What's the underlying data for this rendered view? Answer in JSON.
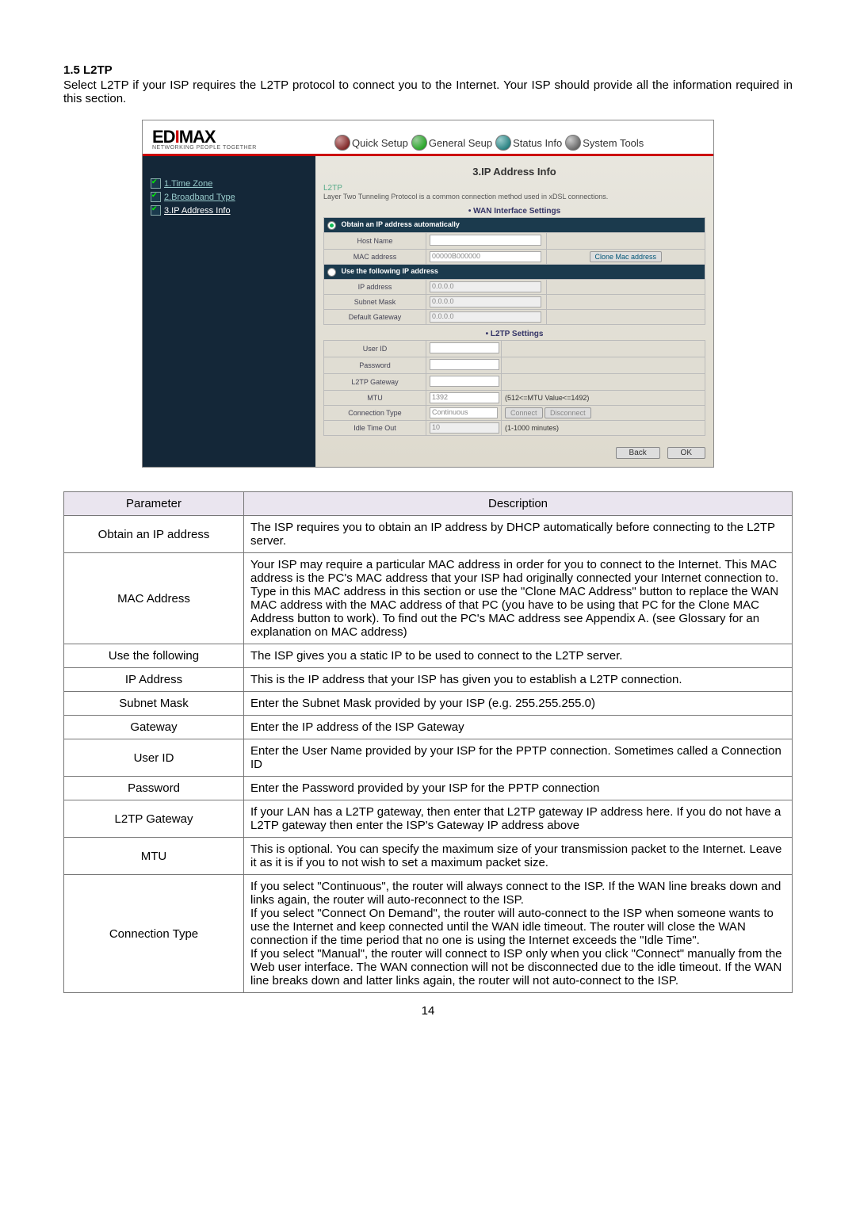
{
  "section_title": "1.5 L2TP",
  "intro_text": "Select L2TP if your ISP requires the L2TP protocol to connect you to the Internet. Your ISP should provide all the information required in this section.",
  "router": {
    "logo_main": "EDIMAX",
    "logo_sub": "NETWORKING PEOPLE TOGETHER",
    "tabs": {
      "quick": "Quick Setup",
      "general": "General Seup",
      "status": "Status Info",
      "system": "System Tools"
    },
    "sidebar": {
      "items": [
        {
          "label": "1.Time Zone"
        },
        {
          "label": "2.Broadband Type"
        },
        {
          "label": "3.IP Address Info"
        }
      ]
    },
    "content": {
      "page_title": "3.IP Address Info",
      "protocol_name": "L2TP",
      "protocol_desc": "Layer Two Tunneling Protocol is a common connection method used in xDSL connections.",
      "wan_heading": "• WAN Interface Settings",
      "radio1_label": "Obtain an IP address automatically",
      "host_name_label": "Host Name",
      "mac_addr_label": "MAC address",
      "mac_addr_value": "00000B000000",
      "clone_btn": "Clone Mac address",
      "radio2_label": "Use the following IP address",
      "ip_addr_label": "IP address",
      "ip_addr_value": "0.0.0.0",
      "subnet_label": "Subnet Mask",
      "subnet_value": "0.0.0.0",
      "gateway_label": "Default Gateway",
      "gateway_value": "0.0.0.0",
      "l2tp_heading": "• L2TP Settings",
      "user_id_label": "User ID",
      "password_label": "Password",
      "l2tp_gw_label": "L2TP Gateway",
      "mtu_label": "MTU",
      "mtu_value": "1392",
      "mtu_hint": "(512<=MTU Value<=1492)",
      "conn_type_label": "Connection Type",
      "conn_type_value": "Continuous",
      "connect_btn": "Connect",
      "disconnect_btn": "Disconnect",
      "idle_label": "Idle Time Out",
      "idle_value": "10",
      "idle_hint": "(1-1000 minutes)",
      "back_btn": "Back",
      "ok_btn": "OK"
    }
  },
  "param_table": {
    "headers": {
      "param": "Parameter",
      "desc": "Description"
    },
    "rows": [
      {
        "param": "Obtain an IP address",
        "desc": "The ISP requires you to obtain an IP address by DHCP automatically before connecting to the L2TP server."
      },
      {
        "param": "MAC Address",
        "desc": "Your ISP may require a particular MAC address in order for you to connect to the Internet. This MAC address is the PC's MAC address that your ISP had originally connected your Internet connection to. Type in this MAC address in this section or use the \"Clone MAC Address\" button to replace the WAN MAC address with the MAC address of that PC (you have to be using that PC for the Clone MAC Address button to work). To find out the PC's MAC address see Appendix A. (see Glossary for an explanation on MAC address)"
      },
      {
        "param": "Use the following",
        "desc": "The ISP gives you a static IP to be used to connect to the L2TP server."
      },
      {
        "param": "IP Address",
        "desc": "This is the IP address that your ISP has given you to establish a L2TP connection."
      },
      {
        "param": "Subnet Mask",
        "desc": "Enter the Subnet Mask provided by your ISP (e.g. 255.255.255.0)"
      },
      {
        "param": "Gateway",
        "desc": "Enter the IP address of the ISP Gateway"
      },
      {
        "param": "User ID",
        "desc": "Enter the User Name provided by your ISP for the PPTP connection. Sometimes called a Connection ID"
      },
      {
        "param": "Password",
        "desc": "Enter the Password provided by your ISP for the PPTP connection"
      },
      {
        "param": "L2TP Gateway",
        "desc": "If your LAN has a L2TP gateway, then enter that L2TP gateway IP address here. If you do not have a L2TP gateway then enter the ISP's Gateway IP address above"
      },
      {
        "param": "MTU",
        "desc": "This is optional. You can specify the maximum size of your transmission packet to the Internet. Leave it as it is if you to not wish to set a maximum packet size."
      },
      {
        "param": "Connection Type",
        "desc": "If you select \"Continuous\", the router will always connect to the ISP. If the WAN line breaks down and links again, the router will auto-reconnect to the ISP.\nIf you select \"Connect On Demand\", the router will auto-connect to the ISP when someone wants to use the Internet and keep connected until the WAN idle timeout. The router will close the WAN connection if the time period that no one is using the Internet exceeds the \"Idle Time\".\nIf you select \"Manual\", the router will connect to ISP only when you click \"Connect\" manually from the Web user interface. The WAN connection will not be disconnected due to the idle timeout. If the WAN line breaks down and latter links again, the router will not auto-connect to the ISP."
      }
    ]
  },
  "page_number": "14"
}
